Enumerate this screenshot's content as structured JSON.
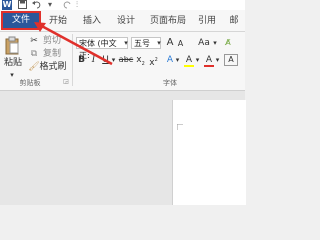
{
  "qat": {
    "app_logo": "W",
    "save_icon": "save-icon",
    "undo_icon": "undo-icon",
    "redo_icon": "redo-icon"
  },
  "tabs": {
    "file": "文件",
    "home": "开始",
    "insert": "插入",
    "design": "设计",
    "layout": "页面布局",
    "references": "引用",
    "mail": "邮"
  },
  "clipboard": {
    "paste": "粘贴",
    "cut": "剪切",
    "copy": "复制",
    "format_painter": "格式刷",
    "group_label": "剪贴板"
  },
  "font": {
    "name": "宋体 (中文正:",
    "size": "五号",
    "grow": "A",
    "shrink": "A",
    "case": "Aa",
    "bold": "B",
    "italic": "I",
    "underline": "U",
    "strike": "abc",
    "subscript": "x",
    "superscript": "x",
    "color_a": "A",
    "highlight": "A",
    "text_color": "A",
    "group_label": "字体"
  },
  "colors": {
    "accent": "#2b579a",
    "arrow": "#e0302b"
  }
}
